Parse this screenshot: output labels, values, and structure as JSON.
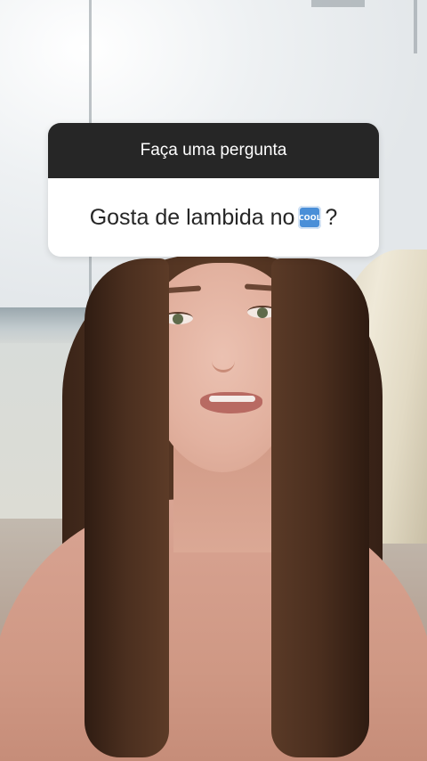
{
  "question_sticker": {
    "header": "Faça uma pergunta",
    "question_text": "Gosta de lambida no",
    "emoji_label": "COOL",
    "question_suffix": "?"
  }
}
